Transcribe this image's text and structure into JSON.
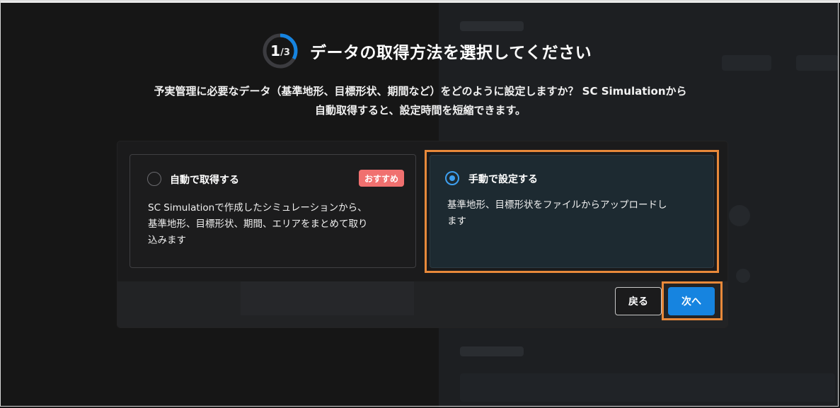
{
  "colors": {
    "accent": "#1684e0",
    "radio_selected": "#3ea0f0",
    "badge": "#f0706f",
    "highlight": "#e8893a"
  },
  "header": {
    "step_current": "1",
    "step_separator": "/",
    "step_total": "3",
    "step_progress": 0.333,
    "title": "データの取得方法を選択してください"
  },
  "description": {
    "line1": "予実管理に必要なデータ（基準地形、目標形状、期間など）をどのように設定しますか？ SC Simulationから",
    "line2": "自動取得すると、設定時間を短縮できます。"
  },
  "options": {
    "auto": {
      "title": "自動で取得する",
      "badge": "おすすめ",
      "selected": false,
      "body_line1": "SC Simulationで作成したシミュレーションから、",
      "body_line2": "基準地形、目標形状、期間、エリアをまとめて取り",
      "body_line3": "込みます"
    },
    "manual": {
      "title": "手動で設定する",
      "selected": true,
      "body_line1": "基準地形、目標形状をファイルからアップロードし",
      "body_line2": "ます"
    }
  },
  "footer": {
    "back_label": "戻る",
    "next_label": "次へ"
  }
}
